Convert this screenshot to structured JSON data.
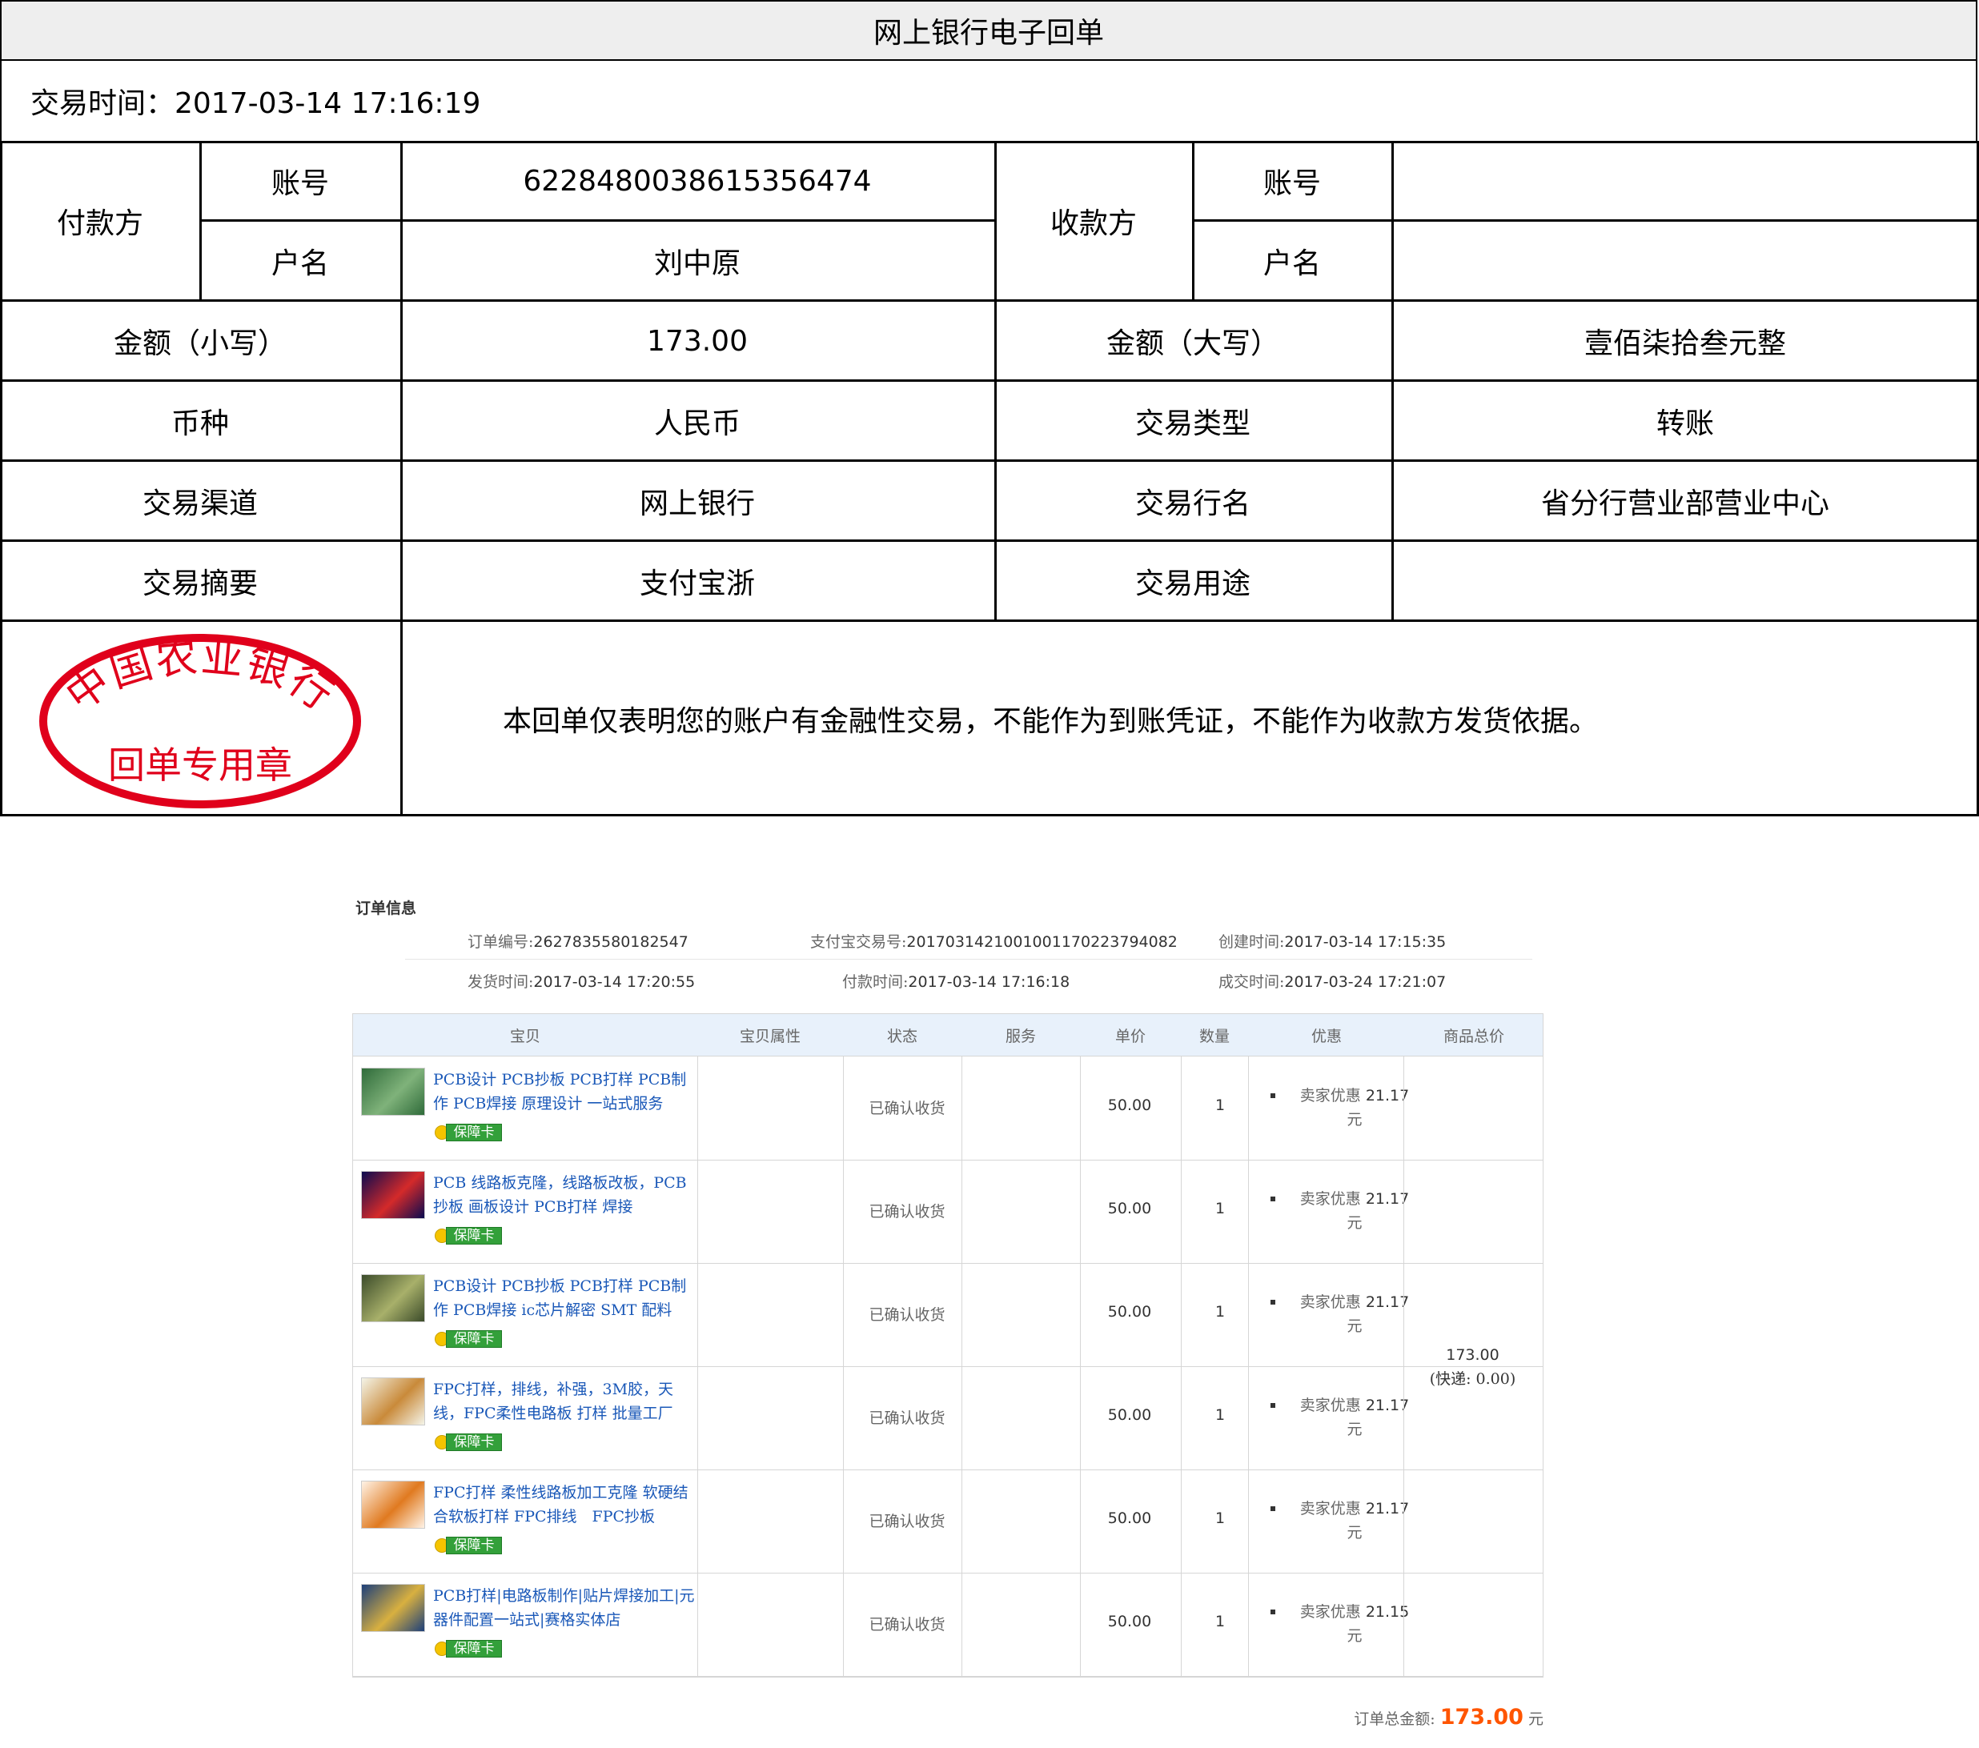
{
  "receipt": {
    "title": "网上银行电子回单",
    "trade_time": "交易时间：2017-03-14 17:16:19",
    "payer_label": "付款方",
    "payee_label": "收款方",
    "account_label": "账号",
    "name_label": "户名",
    "payer_account": "6228480038615356474",
    "payer_name": "刘中原",
    "payee_account": "",
    "payee_name": "",
    "amount_small_label": "金额（小写）",
    "amount_small": "173.00",
    "amount_big_label": "金额（大写）",
    "amount_big": "壹佰柒拾叁元整",
    "currency_label": "币种",
    "currency": "人民币",
    "trade_type_label": "交易类型",
    "trade_type": "转账",
    "channel_label": "交易渠道",
    "channel": "网上银行",
    "bank_label": "交易行名",
    "bank": "省分行营业部营业中心",
    "summary_label": "交易摘要",
    "summary": "支付宝浙",
    "purpose_label": "交易用途",
    "purpose": "",
    "seal_top": "中国农业银行",
    "seal_bottom": "回单专用章",
    "seal_color": "#e0001b",
    "notice": "本回单仅表明您的账户有金融性交易，不能作为到账凭证，不能作为收款方发货依据。"
  },
  "order": {
    "section_title": "订单信息",
    "order_no_label": "订单编号:",
    "order_no": "2627835580182547",
    "alipay_label": "支付宝交易号:",
    "alipay_no": "2017031421001001170223794082",
    "created_label": "创建时间:",
    "created": "2017-03-14 17:15:35",
    "shipped_label": "发货时间:",
    "shipped": "2017-03-14 17:20:55",
    "paid_label": "付款时间:",
    "paid": "2017-03-14 17:16:18",
    "deal_label": "成交时间:",
    "deal": "2017-03-24 17:21:07"
  },
  "table": {
    "headers": [
      "宝贝",
      "宝贝属性",
      "状态",
      "服务",
      "单价",
      "数量",
      "优惠",
      "商品总价"
    ],
    "badge_label": "保障卡",
    "rows": [
      {
        "name": "PCB设计 PCB抄板 PCB打样 PCB制作 PCB焊接 原理设计 一站式服务",
        "status": "已确认收货",
        "price": "50.00",
        "qty": "1",
        "disc_label": "卖家优惠",
        "disc": "21.17",
        "disc_unit": "元"
      },
      {
        "name": "PCB 线路板克隆，线路板改板，PCB抄板 画板设计 PCB打样 焊接",
        "status": "已确认收货",
        "price": "50.00",
        "qty": "1",
        "disc_label": "卖家优惠",
        "disc": "21.17",
        "disc_unit": "元"
      },
      {
        "name": "PCB设计 PCB抄板 PCB打样 PCB制作 PCB焊接 ic芯片解密 SMT 配料",
        "status": "已确认收货",
        "price": "50.00",
        "qty": "1",
        "disc_label": "卖家优惠",
        "disc": "21.17",
        "disc_unit": "元"
      },
      {
        "name": "FPC打样，排线，补强，3M胶，天线，FPC柔性电路板 打样 批量工厂",
        "status": "已确认收货",
        "price": "50.00",
        "qty": "1",
        "disc_label": "卖家优惠",
        "disc": "21.17",
        "disc_unit": "元"
      },
      {
        "name": "FPC打样 柔性线路板加工克隆 软硬结合软板打样 FPC排线　FPC抄板",
        "status": "已确认收货",
        "price": "50.00",
        "qty": "1",
        "disc_label": "卖家优惠",
        "disc": "21.17",
        "disc_unit": "元"
      },
      {
        "name": "PCB打样|电路板制作|贴片焊接加工|元器件配置一站式|赛格实体店",
        "status": "已确认收货",
        "price": "50.00",
        "qty": "1",
        "disc_label": "卖家优惠",
        "disc": "21.15",
        "disc_unit": "元"
      }
    ],
    "total": "173.00",
    "shipping": "(快递: 0.00)"
  },
  "grand_total": {
    "label": "订单总金额:",
    "amount": "173.00",
    "unit": "元"
  }
}
